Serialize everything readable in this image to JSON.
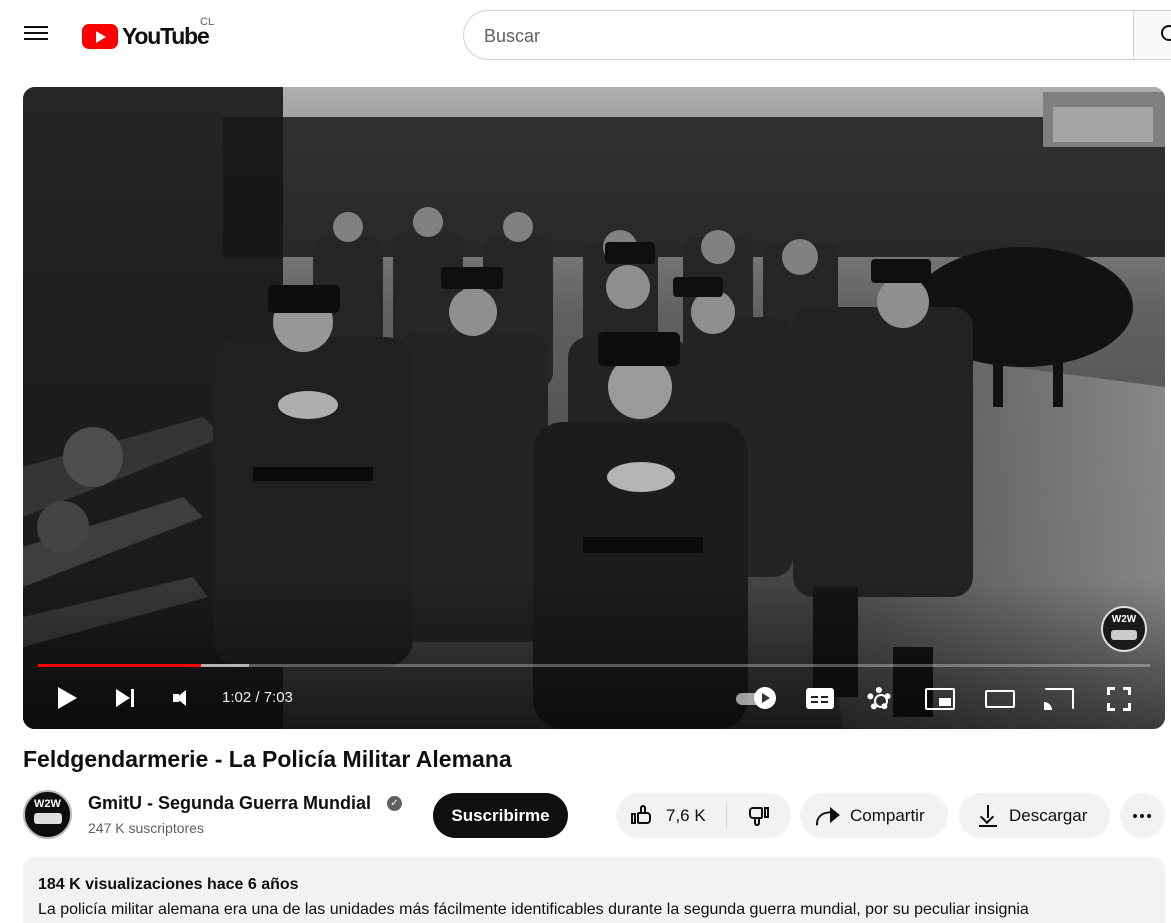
{
  "header": {
    "menu_icon": "menu-icon",
    "logo_text": "YouTube",
    "country_code": "CL",
    "search_placeholder": "Buscar",
    "search_icon": "search-icon"
  },
  "player": {
    "time_display": "1:02 / 7:03",
    "progress_played": 0.147,
    "progress_buffered": 0.19,
    "watermark_text": "W2W",
    "controls": [
      "play-icon",
      "next-icon",
      "volume-icon",
      "autoplay-toggle",
      "subtitles-icon",
      "settings-icon",
      "miniplayer-icon",
      "theater-icon",
      "cast-icon",
      "fullscreen-icon"
    ]
  },
  "video": {
    "title": "Feldgendarmerie - La Policía Militar Alemana"
  },
  "channel": {
    "avatar_text": "W2W",
    "name": "GmitU - Segunda Guerra Mundial",
    "verified": "✓",
    "subscribers": "247 K suscriptores",
    "subscribe_label": "Suscribirme"
  },
  "actions": {
    "like_count": "7,6 K",
    "share_label": "Compartir",
    "download_label": "Descargar"
  },
  "description": {
    "meta": "184 K visualizaciones  hace 6 años",
    "text": "La policía militar alemana era una de las unidades más fácilmente identificables durante la segunda guerra mundial, por su peculiar insignia"
  },
  "colors": {
    "brand_red": "#ff0000",
    "subscribe_bg": "#0f0f0f",
    "pill_bg": "#f2f2f2"
  }
}
